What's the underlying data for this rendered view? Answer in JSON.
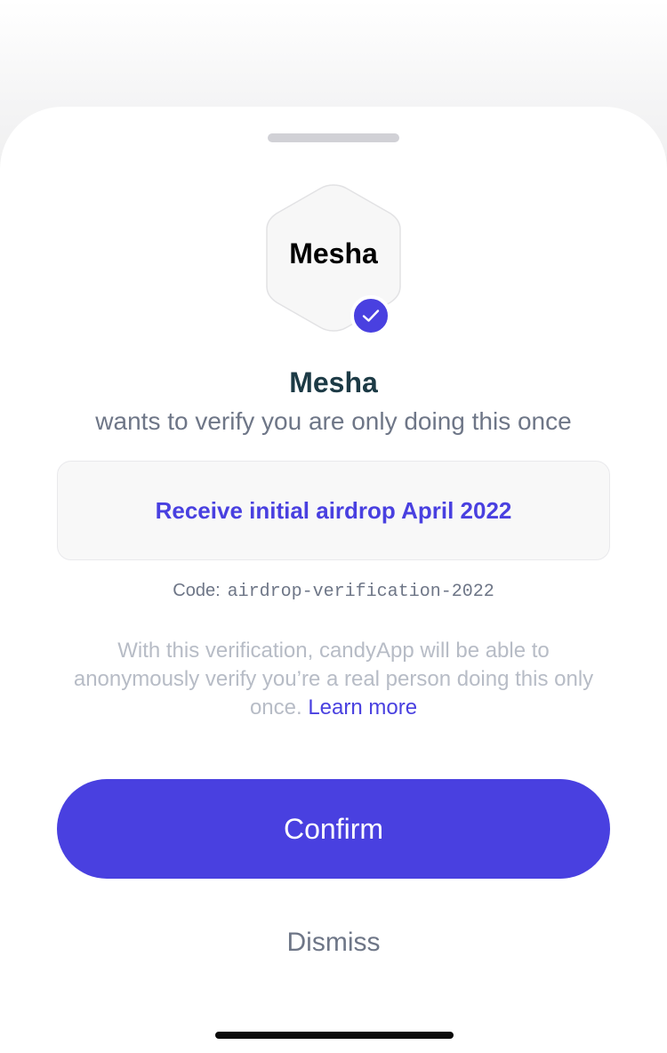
{
  "app": {
    "logo_text": "Mesha",
    "name": "Mesha",
    "subtitle": "wants to verify you are only doing this once",
    "verified_icon": "check-icon"
  },
  "action": {
    "label": "Receive initial airdrop April 2022"
  },
  "code": {
    "label": "Code:",
    "value": "airdrop-verification-2022"
  },
  "description": {
    "text": "With this verification, candyApp will be able to anonymously verify you’re a real person doing this only once. ",
    "learn_more": "Learn more"
  },
  "buttons": {
    "confirm": "Confirm",
    "dismiss": "Dismiss"
  },
  "colors": {
    "accent": "#4940e0",
    "title": "#1c3a45",
    "muted": "#6e7687",
    "light_text": "#b7bcc6"
  }
}
